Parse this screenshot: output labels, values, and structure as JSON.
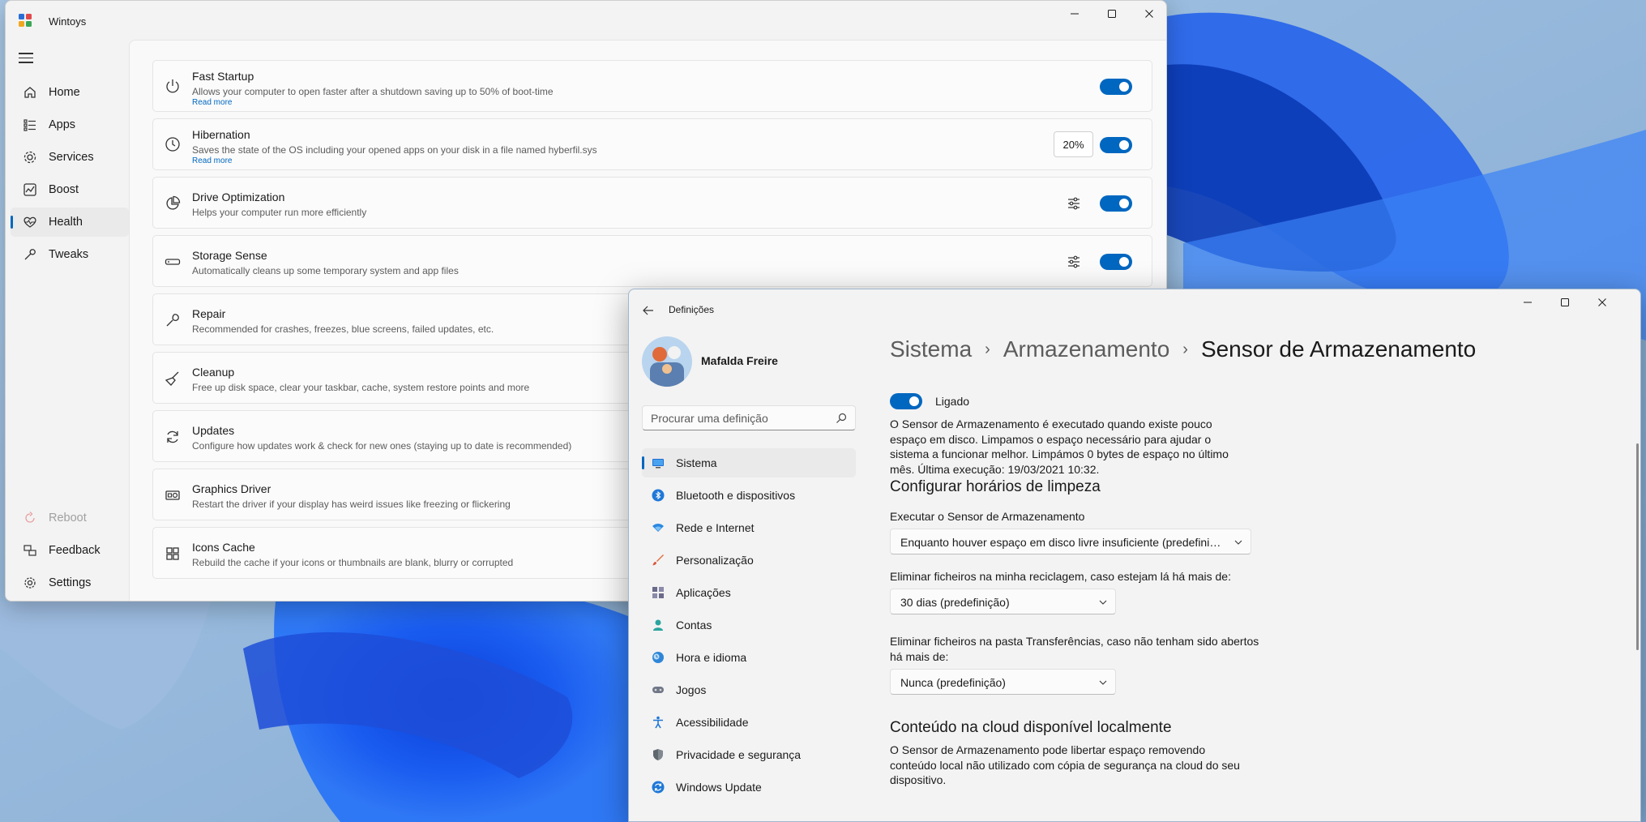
{
  "wintoys": {
    "title": "Wintoys",
    "nav": [
      {
        "label": "Home",
        "icon": "home-icon"
      },
      {
        "label": "Apps",
        "icon": "apps-icon"
      },
      {
        "label": "Services",
        "icon": "services-icon"
      },
      {
        "label": "Boost",
        "icon": "boost-icon"
      },
      {
        "label": "Health",
        "icon": "health-icon"
      },
      {
        "label": "Tweaks",
        "icon": "tweaks-icon"
      }
    ],
    "bottom_nav": [
      {
        "label": "Reboot",
        "icon": "reboot-icon"
      },
      {
        "label": "Feedback",
        "icon": "feedback-icon"
      },
      {
        "label": "Settings",
        "icon": "settings-icon"
      }
    ],
    "active_nav": "Health",
    "accent": "#0067c0",
    "cards": [
      {
        "title": "Fast Startup",
        "desc": "Allows your computer to open faster after a shutdown saving up to 50% of boot-time",
        "more": "Read more",
        "toggle": true
      },
      {
        "title": "Hibernation",
        "desc": "Saves the state of the OS including your opened apps on your disk in a file named hyberfil.sys",
        "more": "Read more",
        "toggle": true,
        "percent": "20%"
      },
      {
        "title": "Drive Optimization",
        "desc": "Helps your computer run more efficiently",
        "toggle": true
      },
      {
        "title": "Storage Sense",
        "desc": "Automatically cleans up some temporary system and app files",
        "toggle": true
      },
      {
        "title": "Repair",
        "desc": "Recommended for crashes, freezes, blue screens, failed updates, etc."
      },
      {
        "title": "Cleanup",
        "desc": "Free up disk space, clear your taskbar, cache, system restore points and more"
      },
      {
        "title": "Updates",
        "desc": "Configure how updates work & check for new ones (staying up to date is recommended)"
      },
      {
        "title": "Graphics Driver",
        "desc": "Restart the driver if your display has weird issues like freezing or flickering"
      },
      {
        "title": "Icons Cache",
        "desc": "Rebuild the cache if your icons or thumbnails are blank, blurry or corrupted"
      }
    ]
  },
  "settings": {
    "title": "Definições",
    "user": "Mafalda Freire",
    "search_placeholder": "Procurar uma definição",
    "nav": [
      {
        "label": "Sistema",
        "icon": "system-icon"
      },
      {
        "label": "Bluetooth e dispositivos",
        "icon": "bluetooth-icon"
      },
      {
        "label": "Rede e Internet",
        "icon": "network-icon"
      },
      {
        "label": "Personalização",
        "icon": "personalization-icon"
      },
      {
        "label": "Aplicações",
        "icon": "apps-icon"
      },
      {
        "label": "Contas",
        "icon": "accounts-icon"
      },
      {
        "label": "Hora e idioma",
        "icon": "time-language-icon"
      },
      {
        "label": "Jogos",
        "icon": "gaming-icon"
      },
      {
        "label": "Acessibilidade",
        "icon": "accessibility-icon"
      },
      {
        "label": "Privacidade e segurança",
        "icon": "privacy-icon"
      },
      {
        "label": "Windows Update",
        "icon": "windows-update-icon"
      }
    ],
    "breadcrumb": [
      "Sistema",
      "Armazenamento",
      "Sensor de Armazenamento"
    ],
    "toggle_label": "Ligado",
    "intro": "O Sensor de Armazenamento é executado quando existe pouco espaço em disco. Limpamos o espaço necessário para ajudar o sistema a funcionar melhor. Limpámos 0 bytes de espaço no último mês. Última execução: 19/03/2021 10:32.",
    "section1": "Configurar horários de limpeza",
    "run_label": "Executar o Sensor de Armazenamento",
    "run_value": "Enquanto houver espaço em disco livre insuficiente (predefinição)",
    "recycle_label": "Eliminar ficheiros na minha reciclagem, caso estejam lá há mais de:",
    "recycle_value": "30 dias (predefinição)",
    "downloads_label": "Eliminar ficheiros na pasta Transferências, caso não tenham sido abertos há mais de:",
    "downloads_value": "Nunca (predefinição)",
    "section2": "Conteúdo na cloud disponível localmente",
    "cloud_text": "O Sensor de Armazenamento pode libertar espaço removendo conteúdo local não utilizado com cópia de segurança na cloud do seu dispositivo."
  }
}
